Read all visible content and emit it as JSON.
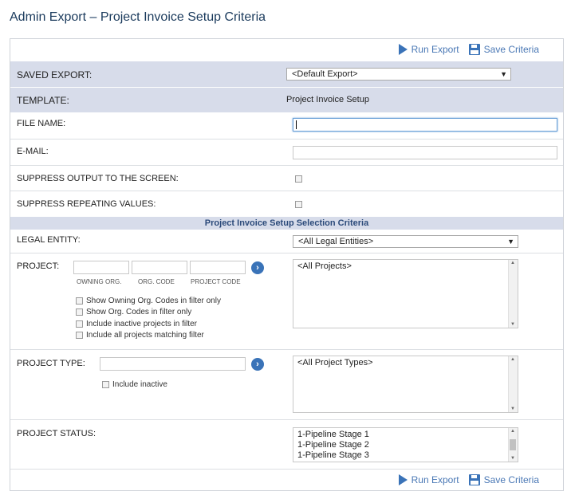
{
  "page": {
    "title": "Admin Export – Project Invoice Setup Criteria"
  },
  "toolbar": {
    "run_label": "Run Export",
    "save_label": "Save Criteria"
  },
  "saved_export": {
    "label": "SAVED EXPORT:",
    "value": "<Default Export>"
  },
  "template": {
    "label": "TEMPLATE:",
    "value": "Project Invoice Setup"
  },
  "file_name": {
    "label": "FILE NAME:",
    "value": ""
  },
  "email": {
    "label": "E-MAIL:",
    "value": ""
  },
  "suppress_output": {
    "label": "SUPPRESS OUTPUT TO THE SCREEN:",
    "checked": false
  },
  "suppress_repeating": {
    "label": "SUPPRESS REPEATING VALUES:",
    "checked": false
  },
  "section": {
    "title": "Project Invoice Setup Selection Criteria"
  },
  "legal_entity": {
    "label": "LEGAL ENTITY:",
    "value": "<All Legal Entities>"
  },
  "project": {
    "label": "PROJECT:",
    "field_labels": [
      "OWNING ORG.",
      "ORG. CODE",
      "PROJECT CODE"
    ],
    "options": [
      "Show Owning Org. Codes in filter only",
      "Show Org. Codes in filter only",
      "Include inactive projects in filter",
      "Include all projects matching filter"
    ],
    "list_items": [
      "<All Projects>"
    ]
  },
  "project_type": {
    "label": "PROJECT TYPE:",
    "include_inactive": "Include inactive",
    "list_items": [
      "<All Project Types>"
    ]
  },
  "project_status": {
    "label": "PROJECT STATUS:",
    "list_items": [
      "1-Pipeline Stage 1",
      "1-Pipeline Stage 2",
      "1-Pipeline Stage 3"
    ]
  },
  "icons": {
    "run": "play-icon",
    "save": "disk-icon",
    "go": "chevron-right-icon"
  }
}
